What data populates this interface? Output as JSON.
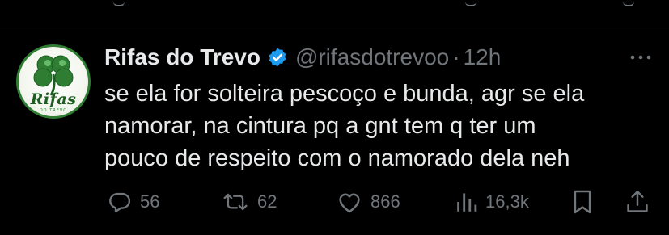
{
  "tweet": {
    "author_name": "Rifas do Trevo",
    "handle": "@rifasdotrevoo",
    "separator": "·",
    "time": "12h",
    "avatar_text": "Rifas",
    "avatar_sub": "DO TREVO",
    "lines": [
      "se ela for solteira pescoço e bunda, agr se ela",
      "namorar, na cintura pq a gnt tem q ter um",
      "pouco de respeito com o namorado dela neh"
    ],
    "verified_icon": "verified-badge-icon",
    "more_icon": "more-options-icon"
  },
  "actions": {
    "replies": "56",
    "reposts": "62",
    "likes": "866",
    "views": "16,3k"
  },
  "colors": {
    "background": "#000000",
    "text": "#e7e9ea",
    "muted": "#71767b",
    "verified": "#1d9bf0",
    "clover": "#2e7d32"
  }
}
